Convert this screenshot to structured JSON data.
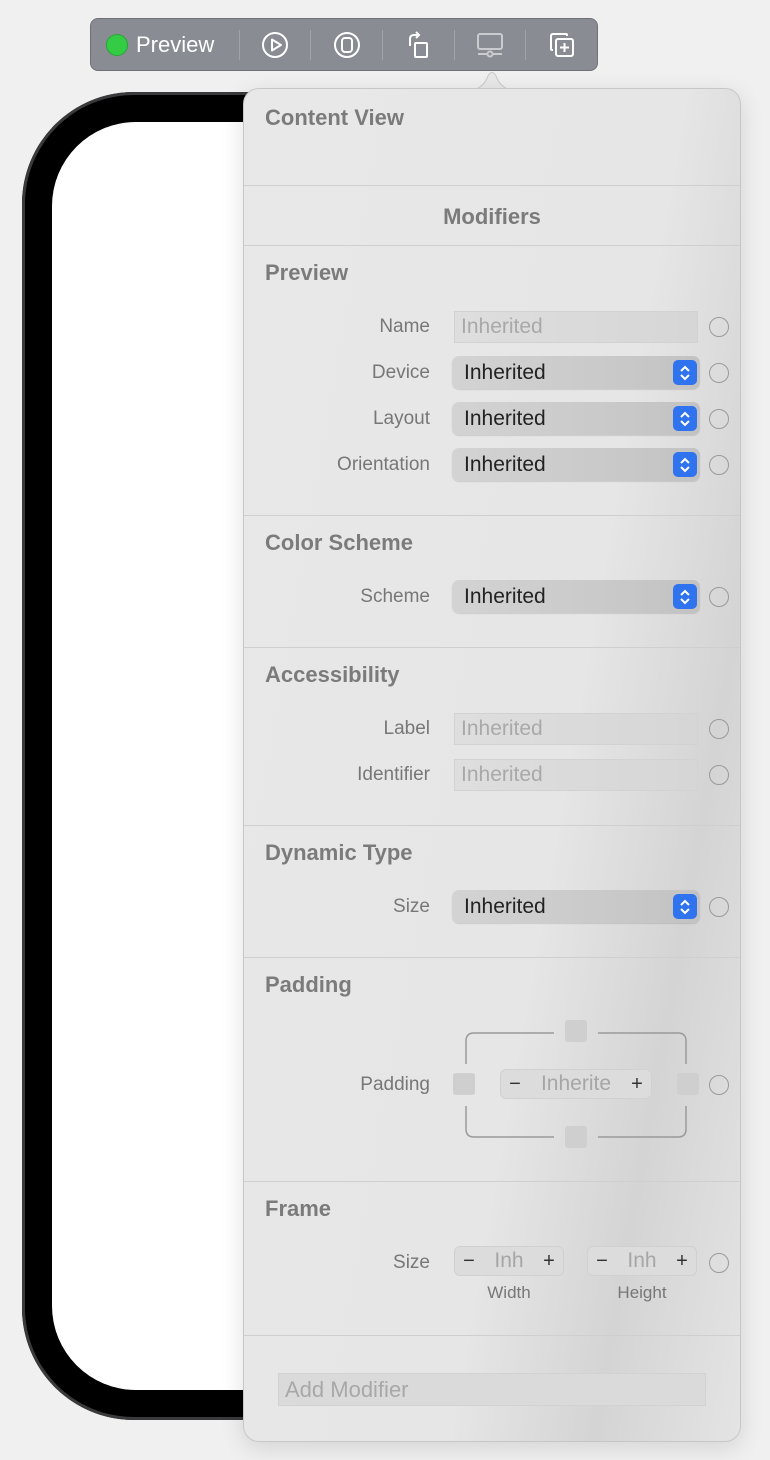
{
  "toolbar": {
    "preview_label": "Preview",
    "status_color": "#33cc44",
    "icons": [
      "live-play-icon",
      "selectable-icon",
      "rotate-device-icon",
      "device-settings-icon",
      "duplicate-preview-icon"
    ]
  },
  "popover": {
    "title": "Content View",
    "modifiers_header": "Modifiers",
    "preview": {
      "title": "Preview",
      "name_label": "Name",
      "name_placeholder": "Inherited",
      "device_label": "Device",
      "device_value": "Inherited",
      "layout_label": "Layout",
      "layout_value": "Inherited",
      "orientation_label": "Orientation",
      "orientation_value": "Inherited"
    },
    "color_scheme": {
      "title": "Color Scheme",
      "scheme_label": "Scheme",
      "scheme_value": "Inherited"
    },
    "accessibility": {
      "title": "Accessibility",
      "label_label": "Label",
      "label_placeholder": "Inherited",
      "identifier_label": "Identifier",
      "identifier_placeholder": "Inherited"
    },
    "dynamic_type": {
      "title": "Dynamic Type",
      "size_label": "Size",
      "size_value": "Inherited"
    },
    "padding": {
      "title": "Padding",
      "padding_label": "Padding",
      "stepper_value": "Inherite",
      "minus": "−",
      "plus": "+"
    },
    "frame": {
      "title": "Frame",
      "size_label": "Size",
      "width_value": "Inh",
      "height_value": "Inh",
      "width_caption": "Width",
      "height_caption": "Height",
      "minus": "−",
      "plus": "+"
    },
    "add_modifier_placeholder": "Add Modifier",
    "accent_color": "#2f73ef"
  }
}
